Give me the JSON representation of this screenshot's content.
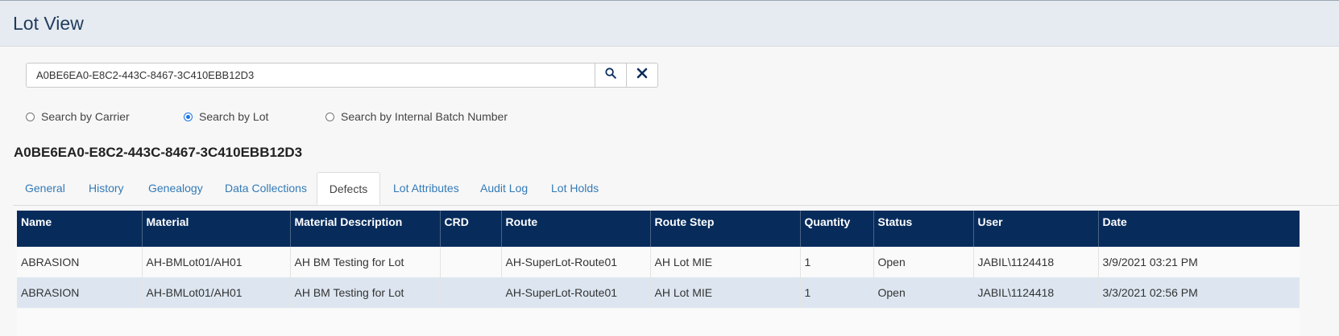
{
  "header": {
    "title": "Lot View"
  },
  "search": {
    "value": "A0BE6EA0-E8C2-443C-8467-3C410EBB12D3",
    "search_icon": "search-icon",
    "clear_icon": "close-icon"
  },
  "search_modes": [
    {
      "label": "Search by Carrier",
      "selected": false
    },
    {
      "label": "Search by Lot",
      "selected": true
    },
    {
      "label": "Search by Internal Batch Number",
      "selected": false
    }
  ],
  "lot": {
    "id": "A0BE6EA0-E8C2-443C-8467-3C410EBB12D3"
  },
  "tabs": [
    {
      "label": "General"
    },
    {
      "label": "History"
    },
    {
      "label": "Genealogy"
    },
    {
      "label": "Data Collections"
    },
    {
      "label": "Defects",
      "active": true
    },
    {
      "label": "Lot Attributes"
    },
    {
      "label": "Audit Log"
    },
    {
      "label": "Lot Holds"
    }
  ],
  "defects_table": {
    "columns": [
      "Name",
      "Material",
      "Material Description",
      "CRD",
      "Route",
      "Route Step",
      "Quantity",
      "Status",
      "User",
      "Date"
    ],
    "rows": [
      [
        "ABRASION",
        "AH-BMLot01/AH01",
        "AH BM Testing for Lot",
        "",
        "AH-SuperLot-Route01",
        "AH Lot MIE",
        "1",
        "Open",
        "JABIL\\1124418",
        "3/9/2021 03:21 PM"
      ],
      [
        "ABRASION",
        "AH-BMLot01/AH01",
        "AH BM Testing for Lot",
        "",
        "AH-SuperLot-Route01",
        "AH Lot MIE",
        "1",
        "Open",
        "JABIL\\1124418",
        "3/3/2021 02:56 PM"
      ]
    ]
  },
  "colors": {
    "header_bg": "#e6ebf1",
    "table_header": "#072c5c",
    "link": "#337ab7",
    "accent": "#1a73e8"
  }
}
